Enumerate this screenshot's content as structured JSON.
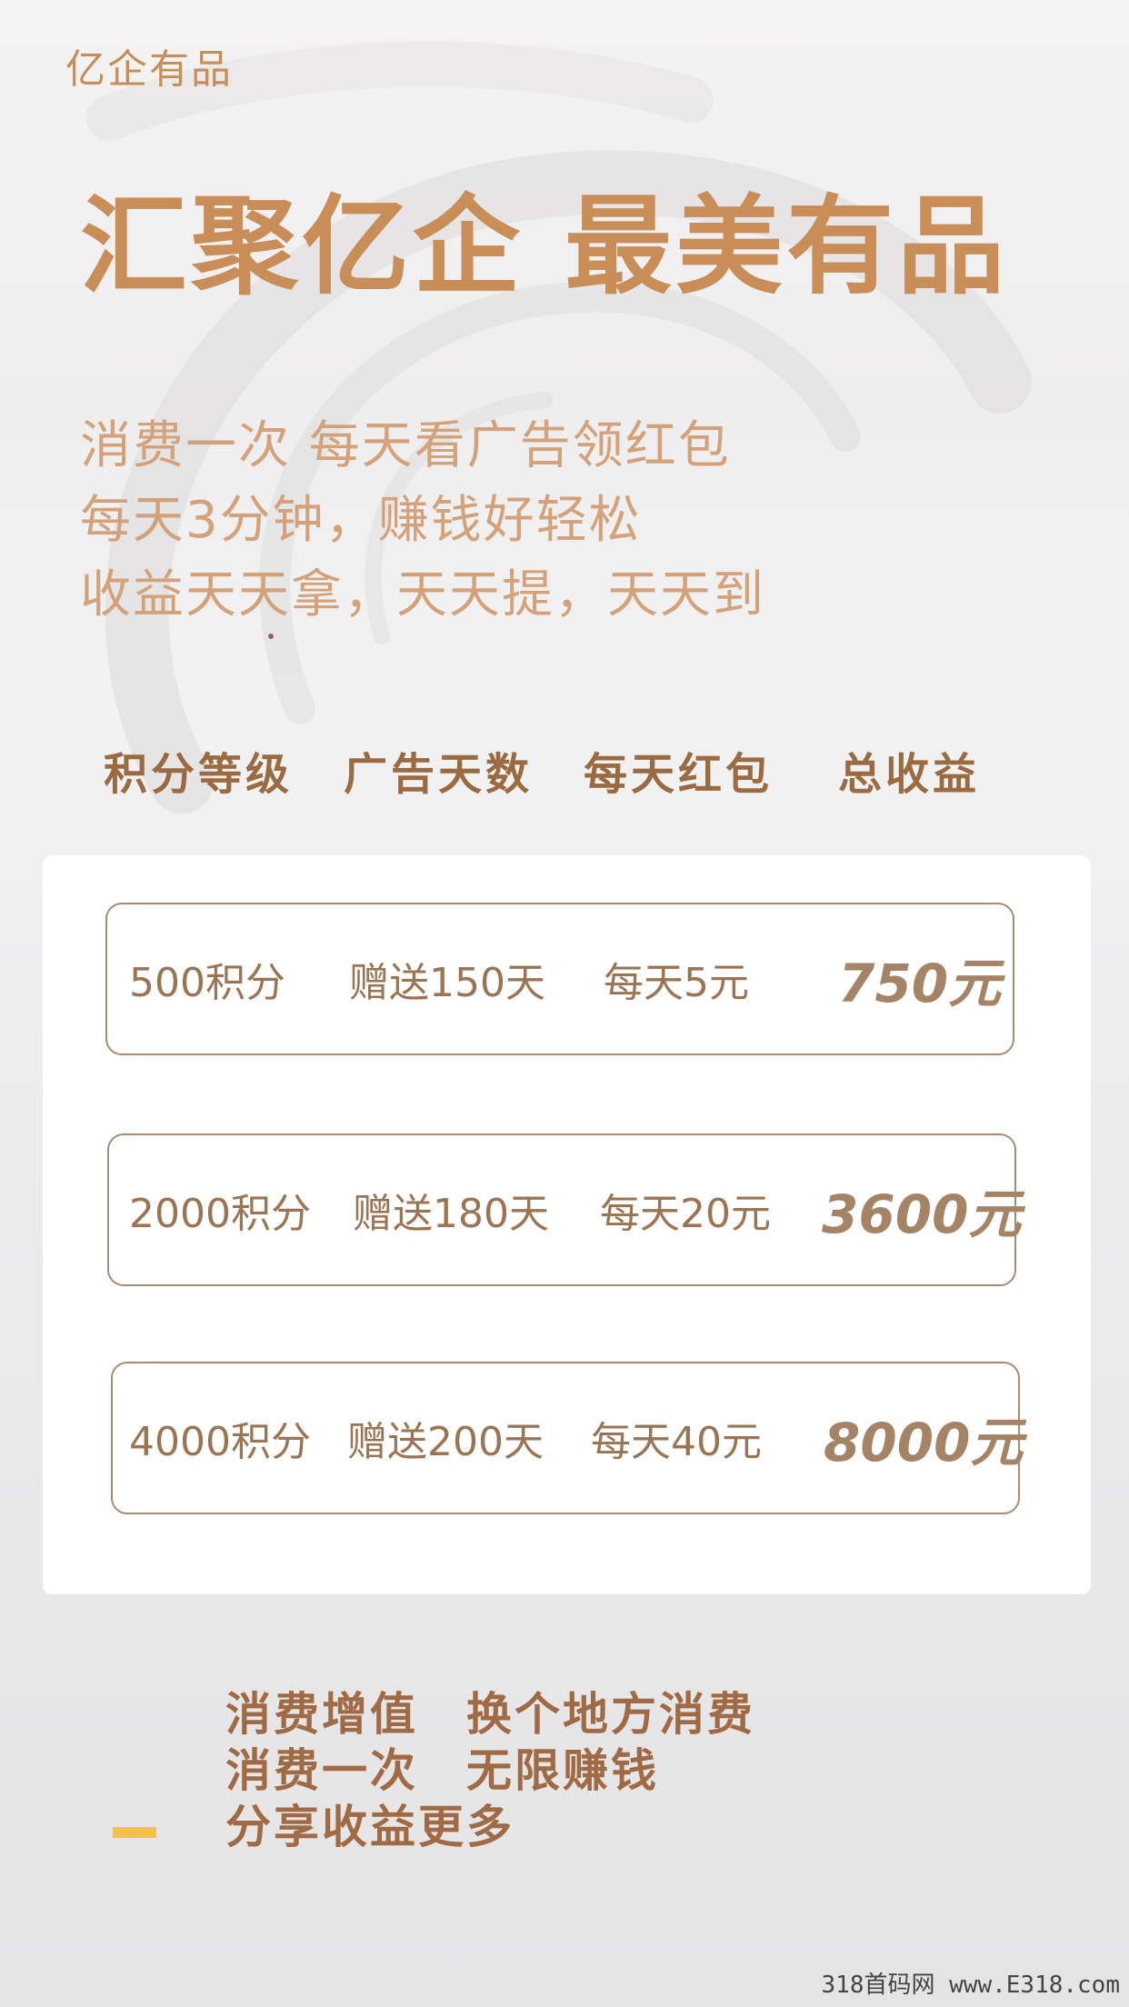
{
  "brand": "亿企有品",
  "headline": "汇聚亿企 最美有品",
  "intro_lines": [
    "消费一次 每天看广告领红包",
    "每天3分钟，赚钱好轻松",
    "收益天天拿，天天提，天天到"
  ],
  "table": {
    "headers": [
      "积分等级",
      "广告天数",
      "每天红包",
      "总收益"
    ],
    "rows": [
      {
        "level": "500积分",
        "days": "赠送150天",
        "daily": "每天5元",
        "total": "750元"
      },
      {
        "level": "2000积分",
        "days": "赠送180天",
        "daily": "每天20元",
        "total": "3600元"
      },
      {
        "level": "4000积分",
        "days": "赠送200天",
        "daily": "每天40元",
        "total": "8000元"
      }
    ]
  },
  "bottom_lines": [
    "消费增值　换个地方消费",
    "消费一次　无限赚钱",
    "分享收益更多"
  ],
  "watermark": "318首码网 www.E318.com",
  "colors": {
    "brand": "#c78f58",
    "headline": "#c98d58",
    "intro": "#d4a27a",
    "row_border": "#a88b73",
    "row_text": "#9b7553",
    "accent_bar": "#f2c14f"
  }
}
